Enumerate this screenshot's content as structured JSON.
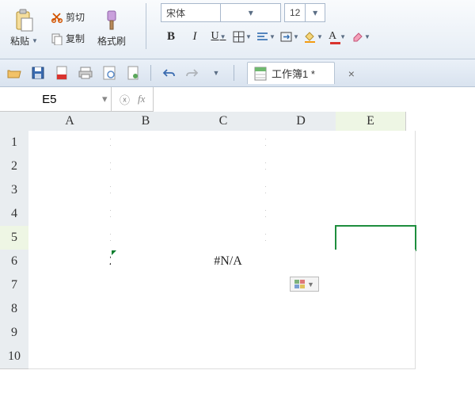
{
  "ribbon": {
    "paste": "粘贴",
    "cut": "剪切",
    "copy": "复制",
    "format_painter": "格式刷",
    "font_name": "宋体",
    "font_size": "12",
    "buttons": {
      "bold": "B",
      "italic": "I",
      "underline": "U"
    }
  },
  "tab": {
    "title": "工作簿1 *"
  },
  "namebox": "E5",
  "formula": "",
  "columns": [
    "A",
    "B",
    "C",
    "D",
    "E"
  ],
  "rows": [
    "1",
    "2",
    "3",
    "4",
    "5",
    "6",
    "7",
    "8",
    "9",
    "10"
  ],
  "cells": {
    "A1": "1",
    "A2": "1",
    "A3": "1",
    "A4": "1",
    "A5": "1",
    "A6": "2",
    "C1": "1",
    "C2": "1",
    "C3": "1",
    "C4": "1",
    "C5": "1",
    "C6": "#N/A"
  },
  "active": {
    "row": 5,
    "col": "E"
  },
  "colors": {
    "accent": "#1e8e3e",
    "orange": "#f39c12"
  }
}
